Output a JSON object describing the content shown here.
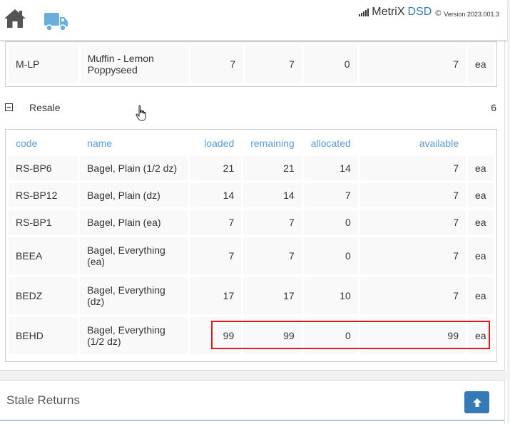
{
  "brand": {
    "name": "MetriX",
    "product": "DSD",
    "copyright": "©",
    "version": "Version 2023.001.3"
  },
  "top_table": {
    "rows": [
      {
        "code": "M-LP",
        "name_line1": "Muffin - Lemon",
        "name_line2": "Poppyseed",
        "loaded": "7",
        "remaining": "7",
        "allocated": "0",
        "available": "7",
        "unit": "ea"
      }
    ]
  },
  "group": {
    "title": "Resale",
    "count": "6"
  },
  "resale_table": {
    "headers": {
      "code": "code",
      "name": "name",
      "loaded": "loaded",
      "remaining": "remaining",
      "allocated": "allocated",
      "available": "available"
    },
    "rows": [
      {
        "code": "RS-BP6",
        "name_line1": "Bagel, Plain (1/2 dz)",
        "name_line2": "",
        "loaded": "21",
        "remaining": "21",
        "allocated": "14",
        "available": "7",
        "unit": "ea"
      },
      {
        "code": "RS-BP12",
        "name_line1": "Bagel, Plain (dz)",
        "name_line2": "",
        "loaded": "14",
        "remaining": "14",
        "allocated": "7",
        "available": "7",
        "unit": "ea"
      },
      {
        "code": "RS-BP1",
        "name_line1": "Bagel, Plain (ea)",
        "name_line2": "",
        "loaded": "7",
        "remaining": "7",
        "allocated": "0",
        "available": "7",
        "unit": "ea"
      },
      {
        "code": "BEEA",
        "name_line1": "Bagel, Everything",
        "name_line2": "(ea)",
        "loaded": "7",
        "remaining": "7",
        "allocated": "0",
        "available": "7",
        "unit": "ea"
      },
      {
        "code": "BEDZ",
        "name_line1": "Bagel, Everything",
        "name_line2": "(dz)",
        "loaded": "17",
        "remaining": "17",
        "allocated": "10",
        "available": "7",
        "unit": "ea"
      },
      {
        "code": "BEHD",
        "name_line1": "Bagel, Everything",
        "name_line2": "(1/2 dz)",
        "loaded": "99",
        "remaining": "99",
        "allocated": "0",
        "available": "99",
        "unit": "ea"
      }
    ]
  },
  "stale_returns": {
    "title": "Stale Returns"
  },
  "colors": {
    "accent": "#337ab7",
    "header_text": "#5b9bd5",
    "highlight": "#e01a1a"
  },
  "icons": {
    "home": "home-icon",
    "truck": "truck-icon",
    "signal": "signal-icon",
    "collapse": "minus-square-icon",
    "cursor": "hand-pointer-icon",
    "scroll_up": "arrow-up-icon"
  }
}
